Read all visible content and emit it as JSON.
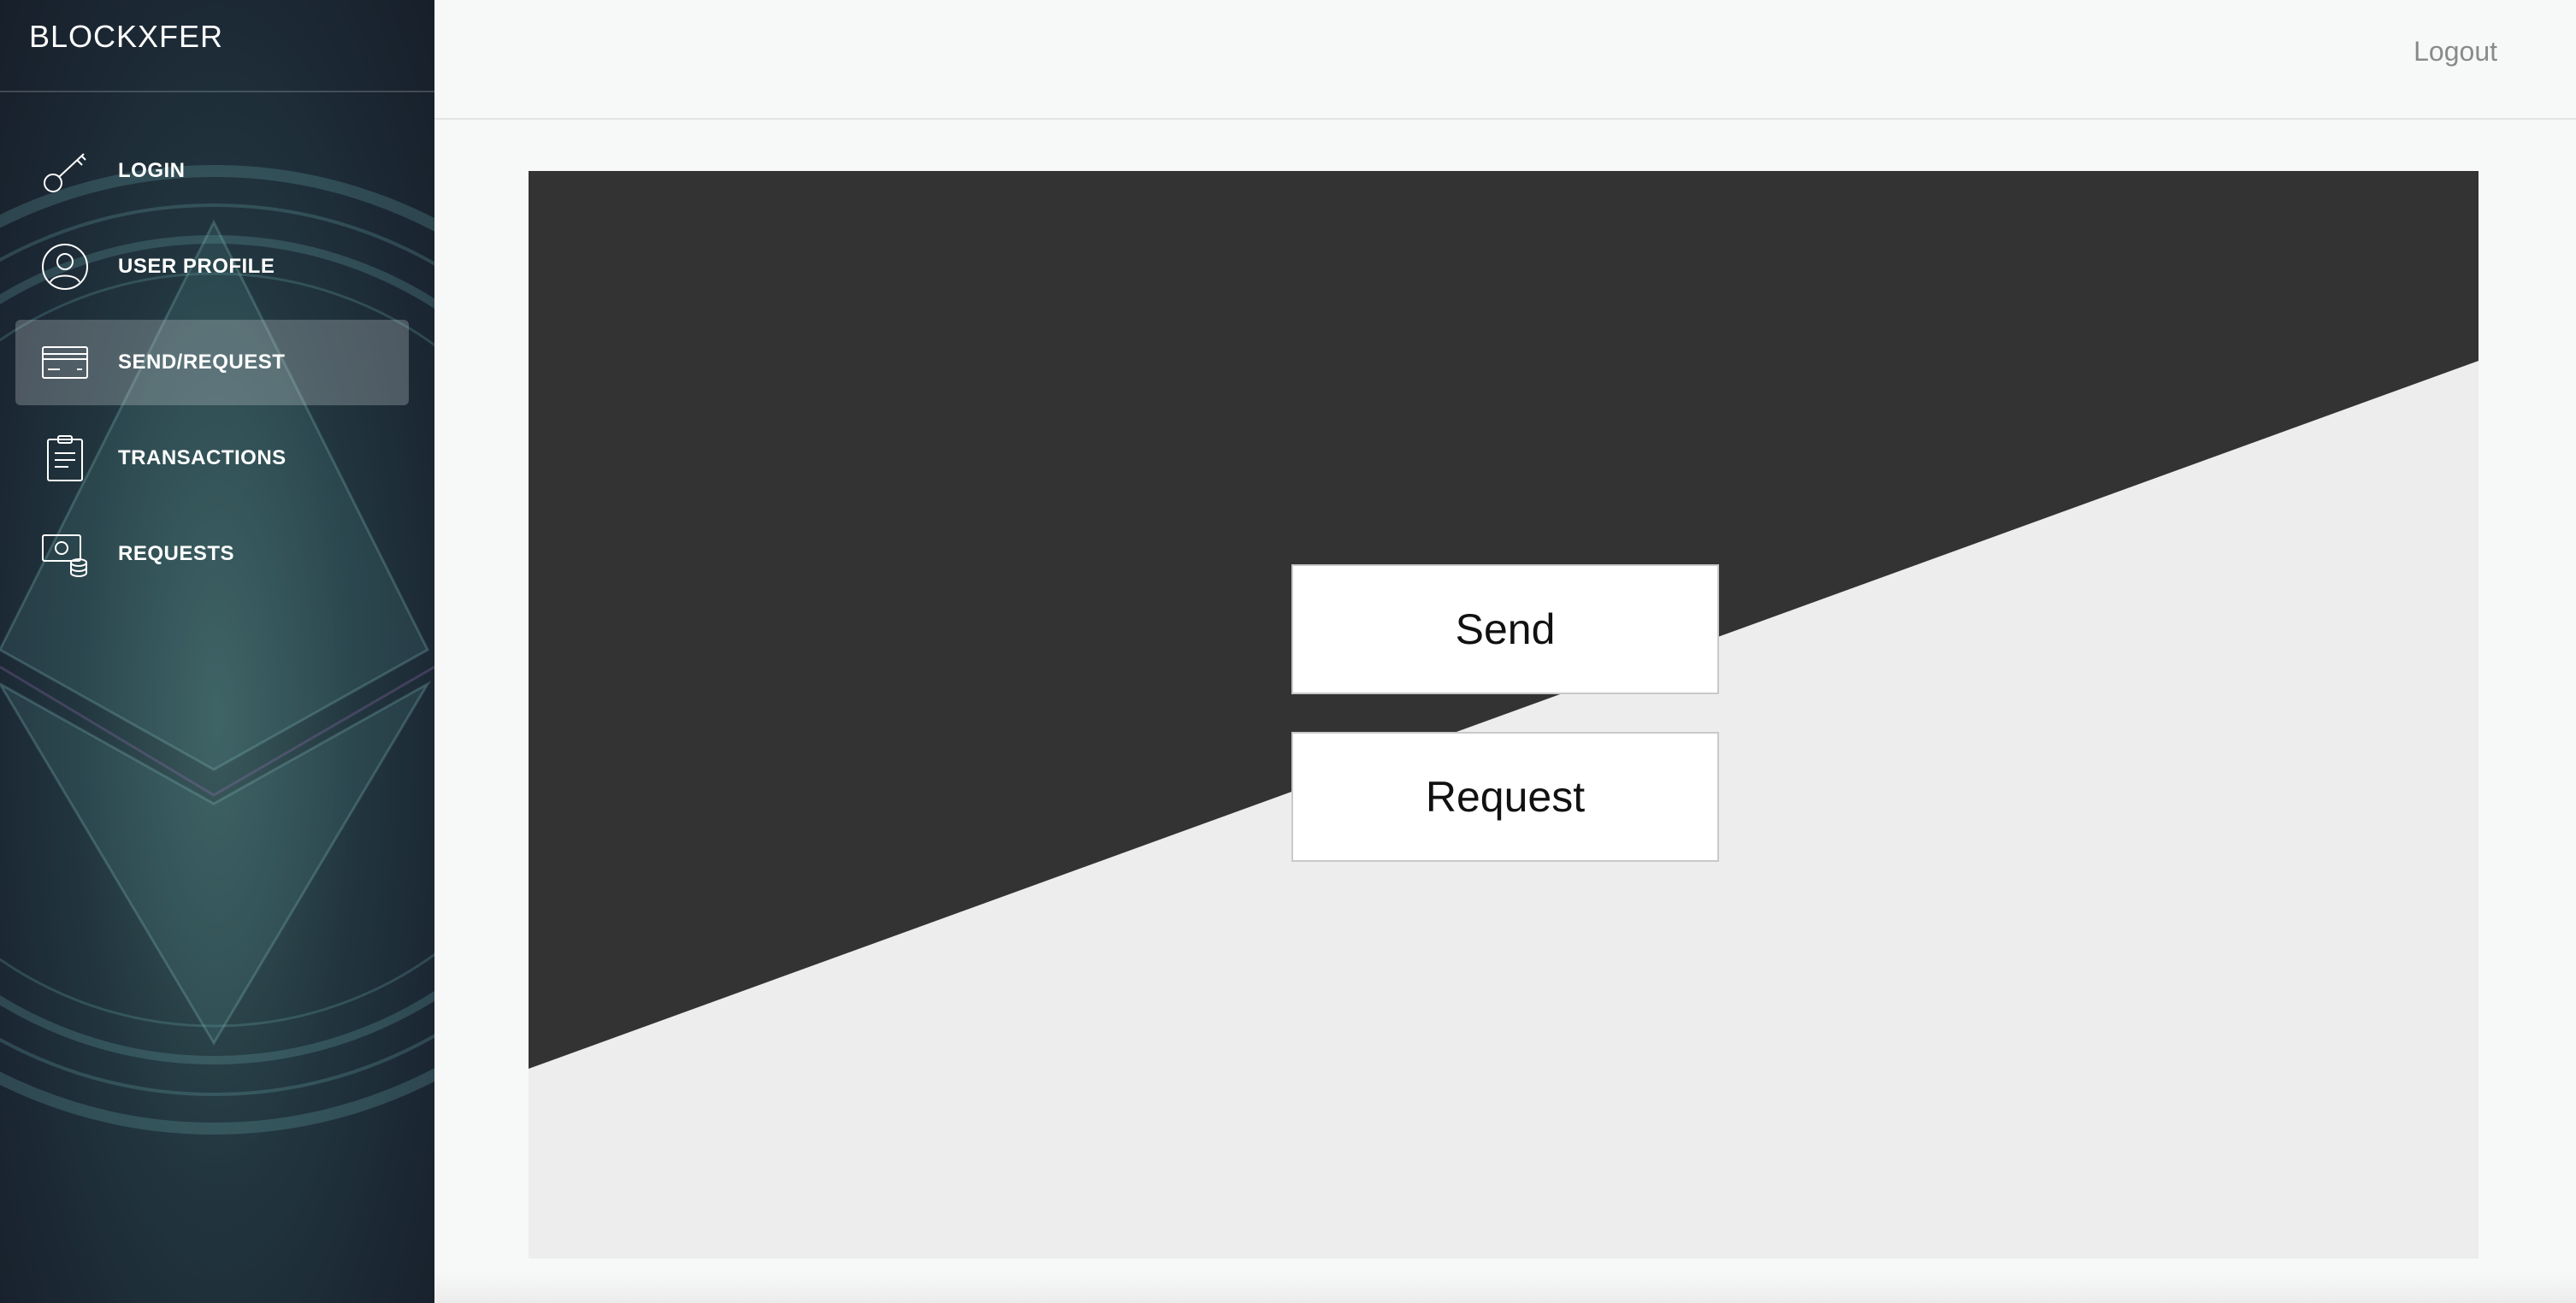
{
  "brand": "BLOCKXFER",
  "header": {
    "logout_label": "Logout"
  },
  "sidebar": {
    "items": [
      {
        "label": "LOGIN",
        "icon": "key-icon",
        "active": false
      },
      {
        "label": "USER PROFILE",
        "icon": "user-circle-icon",
        "active": false
      },
      {
        "label": "SEND/REQUEST",
        "icon": "credit-card-icon",
        "active": true
      },
      {
        "label": "TRANSACTIONS",
        "icon": "clipboard-icon",
        "active": false
      },
      {
        "label": "REQUESTS",
        "icon": "money-coins-icon",
        "active": false
      }
    ]
  },
  "main": {
    "send_label": "Send",
    "request_label": "Request"
  },
  "colors": {
    "sidebar_bg": "#1b2733",
    "card_dark": "#333333",
    "card_light": "#ededed",
    "page_bg": "#f7f8f8"
  }
}
